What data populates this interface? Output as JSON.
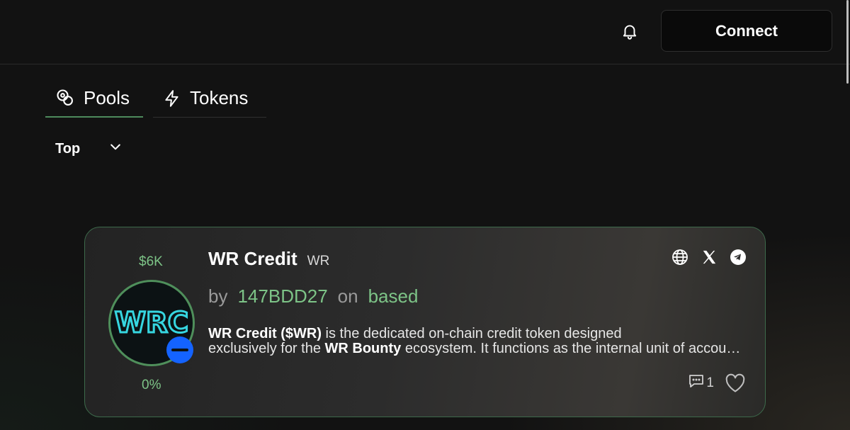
{
  "header": {
    "connect_label": "Connect"
  },
  "tabs": [
    {
      "label": "Pools",
      "icon": "coins-icon",
      "active": true
    },
    {
      "label": "Tokens",
      "icon": "lightning-icon",
      "active": false
    }
  ],
  "filter": {
    "selected": "Top"
  },
  "card": {
    "market_cap": "$6K",
    "change": "0%",
    "avatar_text": "WRC",
    "name": "WR Credit",
    "ticker": "WR",
    "by_label": "by",
    "creator": "147BDD27",
    "on_label": "on",
    "chain": "based",
    "desc_line1_bold": "WR Credit ($WR)",
    "desc_line1_rest": " is the dedicated on-chain credit token designed",
    "desc_line2_start": "exclusively for the ",
    "desc_line2_bold": "WR Bounty",
    "desc_line2_rest": " ecosystem. It functions as the internal unit of account and payment",
    "comments_count": "1",
    "socials": [
      "globe-icon",
      "x-icon",
      "telegram-icon"
    ]
  },
  "colors": {
    "accent_green": "#7dc487",
    "card_border": "#3d6a4b",
    "chain_badge": "#1463ff"
  }
}
